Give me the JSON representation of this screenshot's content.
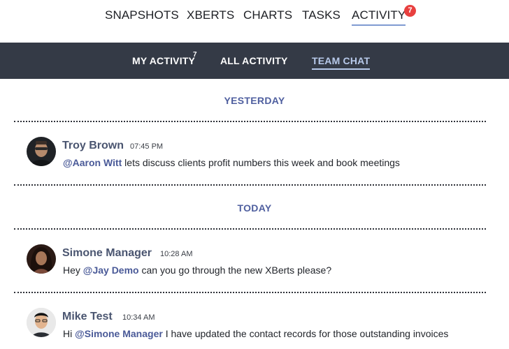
{
  "top_nav": {
    "items": [
      {
        "label": "SNAPSHOTS"
      },
      {
        "label": "XBERTS"
      },
      {
        "label": "CHARTS"
      },
      {
        "label": "TASKS"
      },
      {
        "label": "ACTIVITY",
        "active": true
      }
    ],
    "activity_badge": "7"
  },
  "sub_nav": {
    "items": [
      {
        "label": "MY ACTIVITY",
        "count": "7"
      },
      {
        "label": "ALL ACTIVITY"
      },
      {
        "label": "TEAM CHAT",
        "active": true
      }
    ]
  },
  "feed": {
    "sections": [
      {
        "day": "YESTERDAY",
        "messages": [
          {
            "author": "Troy Brown",
            "time": "07:45 PM",
            "mention": "@Aaron Witt",
            "prefix": "",
            "text": " lets discuss clients profit numbers this week and book meetings"
          }
        ]
      },
      {
        "day": "TODAY",
        "messages": [
          {
            "author": "Simone Manager",
            "time": "10:28 AM",
            "prefix": "Hey ",
            "mention": "@Jay Demo",
            "text": " can you go through the new XBerts please?"
          },
          {
            "author": "Mike Test",
            "time": "10:34 AM",
            "prefix": "Hi ",
            "mention": "@Simone Manager",
            "text": " I have updated the contact records for those outstanding invoices"
          }
        ]
      }
    ]
  },
  "colors": {
    "subnav_bg": "#343a46",
    "accent": "#4f5f9f",
    "badge": "#e8403f"
  }
}
